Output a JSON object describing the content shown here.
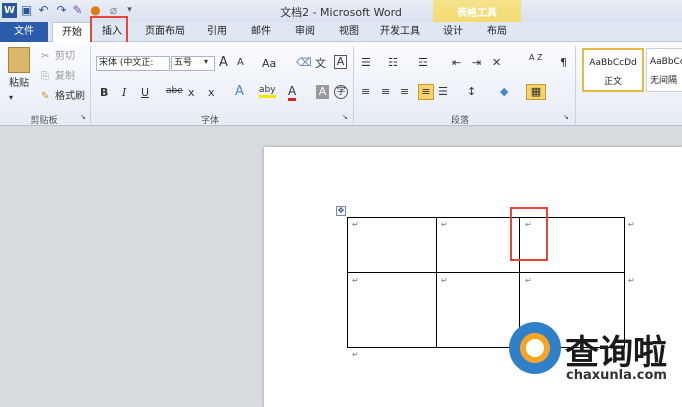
{
  "window": {
    "title": "文档2 - Microsoft Word",
    "context_tab_group": "表格工具",
    "quick_access": [
      "W",
      "save",
      "undo",
      "redo",
      "format-painter",
      "color",
      "eraser",
      "customize"
    ]
  },
  "tabs": [
    {
      "label": "文件"
    },
    {
      "label": "开始"
    },
    {
      "label": "插入"
    },
    {
      "label": "页面布局"
    },
    {
      "label": "引用"
    },
    {
      "label": "邮件"
    },
    {
      "label": "审阅"
    },
    {
      "label": "视图"
    },
    {
      "label": "开发工具"
    },
    {
      "label": "设计"
    },
    {
      "label": "布局"
    }
  ],
  "ribbon": {
    "clipboard": {
      "paste": "粘贴",
      "cut": "剪切",
      "copy": "复制",
      "format_painter": "格式刷",
      "group": "剪贴板"
    },
    "font": {
      "font_name": "宋体 (中文正:",
      "font_size": "五号",
      "grow": "A",
      "shrink": "A",
      "change_case": "Aa",
      "clear_format": "",
      "phonetic": "文",
      "border_char": "A",
      "bold": "B",
      "italic": "I",
      "underline": "U",
      "strike": "abe",
      "sub": "x",
      "sup": "x",
      "text_effect": "A",
      "highlight": "aby",
      "font_color": "A",
      "char_shading": "A",
      "enclose": "字",
      "group": "字体"
    },
    "paragraph": {
      "group": "段落",
      "sort": "A Z"
    },
    "styles": [
      {
        "preview": "AaBbCcDd",
        "name": "正文"
      },
      {
        "preview": "AaBbCc",
        "name": "无间隔"
      }
    ]
  },
  "watermark": {
    "text": "查询啦",
    "url": "chaxunla.com"
  },
  "colors": {
    "file_tab": "#2a5caa",
    "highlight_box": "#e8453c",
    "context": "#f0d45c"
  }
}
